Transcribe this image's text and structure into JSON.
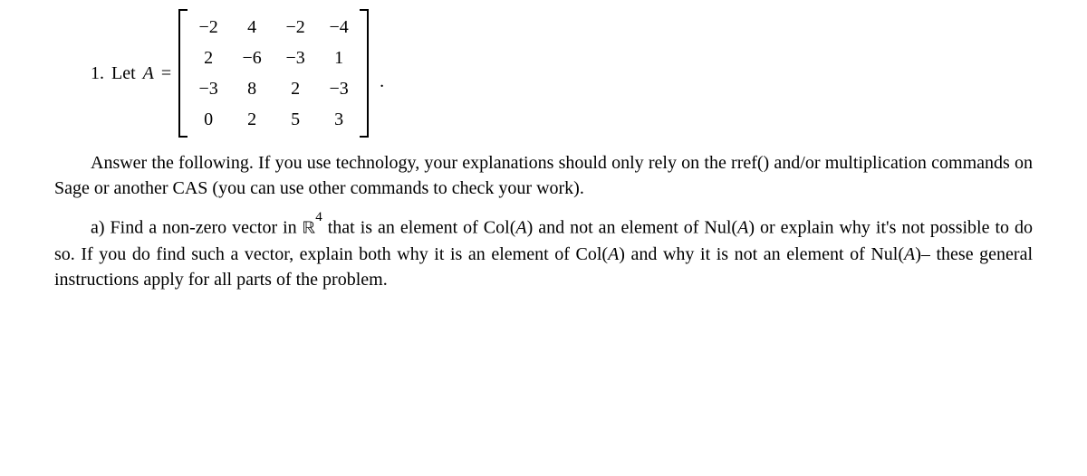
{
  "problem": {
    "number": "1.",
    "letVar": "A",
    "equals": "=",
    "trailingPeriod": ".",
    "matrix": {
      "rows": [
        [
          "−2",
          "4",
          "−2",
          "−4"
        ],
        [
          "2",
          "−6",
          "−3",
          "1"
        ],
        [
          "−3",
          "8",
          "2",
          "−3"
        ],
        [
          "0",
          "2",
          "5",
          "3"
        ]
      ]
    }
  },
  "p1": {
    "t1": "Answer the following. If you use technology, your explanations should only rely on the rref() and/or multiplication commands on Sage or another CAS (you can use other commands to check your work)."
  },
  "partA": {
    "label": "a)",
    "t1": "Find a non-zero vector in ",
    "space": "ℝ",
    "exp": "4",
    "t2": " that is an element of Col(",
    "A1": "A",
    "t3": ") and not an element of Nul(",
    "A2": "A",
    "t4": ") or explain why it's not possible to do so. If you do find such a vector, explain both why it is an element of Col(",
    "A3": "A",
    "t5": ") and why it is not an element of Nul(",
    "A4": "A",
    "t6": ")– these general instructions apply for all parts of the problem."
  }
}
